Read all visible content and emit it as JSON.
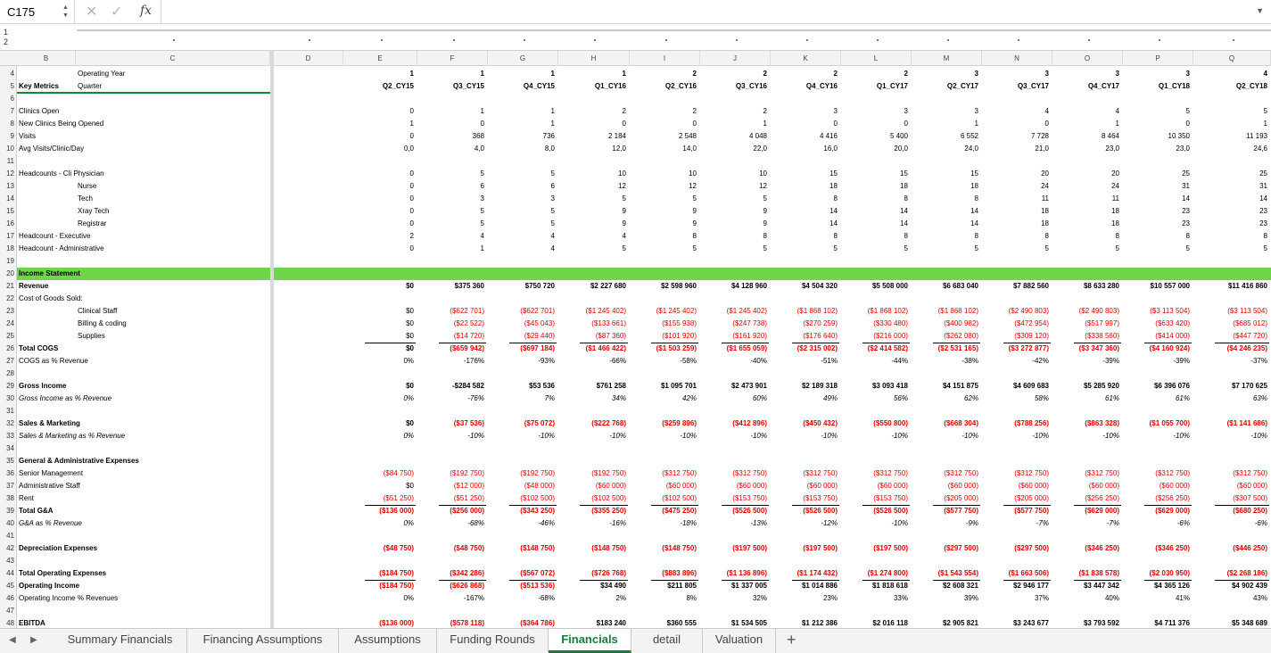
{
  "formula_bar": {
    "cell_ref": "C175",
    "cancel_icon": "✕",
    "confirm_icon": "✓",
    "fx_label": "fx",
    "formula": ""
  },
  "outline": {
    "levels": [
      "1",
      "2"
    ]
  },
  "columns": [
    "B",
    "C",
    "D",
    "E",
    "F",
    "G",
    "H",
    "I",
    "J",
    "K",
    "L",
    "M",
    "N",
    "O",
    "P",
    "Q"
  ],
  "period_columns": [
    "E",
    "F",
    "G",
    "H",
    "I",
    "J",
    "K",
    "L",
    "M",
    "N",
    "O",
    "P",
    "Q"
  ],
  "rows": [
    {
      "n": "1",
      "b": "",
      "c": "",
      "style": "",
      "values": []
    },
    {
      "n": "2",
      "b": "",
      "c": "",
      "style": "",
      "values": []
    },
    {
      "n": "4",
      "b": "",
      "c": "Operating Year",
      "style": "hdr",
      "values": [
        "1",
        "1",
        "1",
        "1",
        "2",
        "2",
        "2",
        "2",
        "3",
        "3",
        "3",
        "3",
        "4"
      ]
    },
    {
      "n": "5",
      "b": "Key Metrics",
      "c": "Quarter",
      "style": "hdr",
      "values": [
        "Q2_CY15",
        "Q3_CY15",
        "Q4_CY15",
        "Q1_CY16",
        "Q2_CY16",
        "Q3_CY16",
        "Q4_CY16",
        "Q1_CY17",
        "Q2_CY17",
        "Q3_CY17",
        "Q4_CY17",
        "Q1_CY18",
        "Q2_CY18"
      ]
    },
    {
      "n": "6",
      "b": "",
      "c": "",
      "style": "",
      "values": []
    },
    {
      "n": "7",
      "b": "Clinics Open",
      "c": "",
      "style": "",
      "values": [
        "0",
        "1",
        "1",
        "2",
        "2",
        "2",
        "3",
        "3",
        "3",
        "4",
        "4",
        "5",
        "5"
      ]
    },
    {
      "n": "8",
      "b": "New Clinics Being Opened",
      "c": "",
      "style": "",
      "values": [
        "1",
        "0",
        "1",
        "0",
        "0",
        "1",
        "0",
        "0",
        "1",
        "0",
        "1",
        "0",
        "1"
      ]
    },
    {
      "n": "9",
      "b": "Visits",
      "c": "",
      "style": "",
      "values": [
        "0",
        "368",
        "736",
        "2 184",
        "2 548",
        "4 048",
        "4 416",
        "5 400",
        "6 552",
        "7 728",
        "8 464",
        "10 350",
        "11 193"
      ]
    },
    {
      "n": "10",
      "b": "Avg Visits/Clinic/Day",
      "c": "",
      "style": "",
      "values": [
        "0,0",
        "4,0",
        "8,0",
        "12,0",
        "14,0",
        "22,0",
        "16,0",
        "20,0",
        "24,0",
        "21,0",
        "23,0",
        "23,0",
        "24,6"
      ]
    },
    {
      "n": "11",
      "b": "",
      "c": "",
      "style": "",
      "values": []
    },
    {
      "n": "12",
      "b": "Headcounts - Cli Physician",
      "c": "",
      "style": "",
      "values": [
        "0",
        "5",
        "5",
        "10",
        "10",
        "10",
        "15",
        "15",
        "15",
        "20",
        "20",
        "25",
        "25"
      ]
    },
    {
      "n": "13",
      "b": "",
      "c": "Nurse",
      "style": "",
      "values": [
        "0",
        "6",
        "6",
        "12",
        "12",
        "12",
        "18",
        "18",
        "18",
        "24",
        "24",
        "31",
        "31"
      ]
    },
    {
      "n": "14",
      "b": "",
      "c": "Tech",
      "style": "",
      "values": [
        "0",
        "3",
        "3",
        "5",
        "5",
        "5",
        "8",
        "8",
        "8",
        "11",
        "11",
        "14",
        "14"
      ]
    },
    {
      "n": "15",
      "b": "",
      "c": "Xray Tech",
      "style": "",
      "values": [
        "0",
        "5",
        "5",
        "9",
        "9",
        "9",
        "14",
        "14",
        "14",
        "18",
        "18",
        "23",
        "23"
      ]
    },
    {
      "n": "16",
      "b": "",
      "c": "Registrar",
      "style": "",
      "values": [
        "0",
        "5",
        "5",
        "9",
        "9",
        "9",
        "14",
        "14",
        "14",
        "18",
        "18",
        "23",
        "23"
      ]
    },
    {
      "n": "17",
      "b": "Headcount - Executive",
      "c": "",
      "style": "",
      "values": [
        "2",
        "4",
        "4",
        "4",
        "8",
        "8",
        "8",
        "8",
        "8",
        "8",
        "8",
        "8",
        "8"
      ]
    },
    {
      "n": "18",
      "b": "Headcount - Administrative",
      "c": "",
      "style": "",
      "values": [
        "0",
        "1",
        "4",
        "5",
        "5",
        "5",
        "5",
        "5",
        "5",
        "5",
        "5",
        "5",
        "5"
      ]
    },
    {
      "n": "19",
      "b": "",
      "c": "",
      "style": "",
      "values": []
    },
    {
      "n": "20",
      "b": "Income Statement",
      "c": "",
      "style": "hl",
      "values": []
    },
    {
      "n": "21",
      "b": "Revenue",
      "c": "",
      "style": "b",
      "values": [
        "$0",
        "$375 360",
        "$750 720",
        "$2 227 680",
        "$2 598 960",
        "$4 128 960",
        "$4 504 320",
        "$5 508 000",
        "$6 683 040",
        "$7 882 560",
        "$8 633 280",
        "$10 557 000",
        "$11 416 860"
      ]
    },
    {
      "n": "22",
      "b": "Cost of Goods Sold:",
      "c": "",
      "style": "",
      "values": []
    },
    {
      "n": "23",
      "b": "",
      "c": "Clinical Staff",
      "style": "neg",
      "values": [
        "$0",
        "($622 701)",
        "($622 701)",
        "($1 245 402)",
        "($1 245 402)",
        "($1 245 402)",
        "($1 868 102)",
        "($1 868 102)",
        "($1 868 102)",
        "($2 490 803)",
        "($2 490 803)",
        "($3 113 504)",
        "($3 113 504)"
      ]
    },
    {
      "n": "24",
      "b": "",
      "c": "Billing & coding",
      "style": "neg",
      "values": [
        "$0",
        "($22 522)",
        "($45 043)",
        "($133 661)",
        "($155 938)",
        "($247 738)",
        "($270 259)",
        "($330 480)",
        "($400 982)",
        "($472 954)",
        "($517 997)",
        "($633 420)",
        "($685 012)"
      ]
    },
    {
      "n": "25",
      "b": "",
      "c": "Supplies",
      "style": "neg",
      "values": [
        "$0",
        "($14 720)",
        "($29 440)",
        "($87 360)",
        "($101 920)",
        "($161 920)",
        "($176 640)",
        "($216 000)",
        "($262 080)",
        "($309 120)",
        "($338 560)",
        "($414 000)",
        "($447 720)"
      ]
    },
    {
      "n": "26",
      "b": "Total COGS",
      "c": "",
      "style": "b neg",
      "values": [
        "$0",
        "($659 942)",
        "($697 184)",
        "($1 466 422)",
        "($1 503 259)",
        "($1 655 059)",
        "($2 315 002)",
        "($2 414 582)",
        "($2 531 165)",
        "($3 272 877)",
        "($3 347 360)",
        "($4 160 924)",
        "($4 246 235)"
      ]
    },
    {
      "n": "27",
      "b": "COGS as % Revenue",
      "c": "",
      "style": "",
      "values": [
        "0%",
        "-176%",
        "-93%",
        "-66%",
        "-58%",
        "-40%",
        "-51%",
        "-44%",
        "-38%",
        "-42%",
        "-39%",
        "-39%",
        "-37%"
      ]
    },
    {
      "n": "28",
      "b": "",
      "c": "",
      "style": "",
      "values": []
    },
    {
      "n": "29",
      "b": "Gross Income",
      "c": "",
      "style": "b",
      "values": [
        "$0",
        "-$284 582",
        "$53 536",
        "$761 258",
        "$1 095 701",
        "$2 473 901",
        "$2 189 318",
        "$3 093 418",
        "$4 151 875",
        "$4 609 683",
        "$5 285 920",
        "$6 396 076",
        "$7 170 625"
      ]
    },
    {
      "n": "30",
      "b": "Gross Income as % Revenue",
      "c": "",
      "style": "i",
      "values": [
        "0%",
        "-76%",
        "7%",
        "34%",
        "42%",
        "60%",
        "49%",
        "56%",
        "62%",
        "58%",
        "61%",
        "61%",
        "63%"
      ]
    },
    {
      "n": "31",
      "b": "",
      "c": "",
      "style": "",
      "values": []
    },
    {
      "n": "32",
      "b": "Sales & Marketing",
      "c": "",
      "style": "b negv",
      "values": [
        "$0",
        "($37 536)",
        "($75 072)",
        "($222 768)",
        "($259 896)",
        "($412 896)",
        "($450 432)",
        "($550 800)",
        "($668 304)",
        "($788 256)",
        "($863 328)",
        "($1 055 700)",
        "($1 141 686)"
      ]
    },
    {
      "n": "33",
      "b": "Sales & Marketing as % Revenue",
      "c": "",
      "style": "i",
      "values": [
        "0%",
        "-10%",
        "-10%",
        "-10%",
        "-10%",
        "-10%",
        "-10%",
        "-10%",
        "-10%",
        "-10%",
        "-10%",
        "-10%",
        "-10%"
      ]
    },
    {
      "n": "34",
      "b": "",
      "c": "",
      "style": "",
      "values": []
    },
    {
      "n": "35",
      "b": "General & Administrative Expenses",
      "c": "",
      "style": "b",
      "values": []
    },
    {
      "n": "36",
      "b": "Senior Management",
      "c": "",
      "style": "neg",
      "values": [
        "($84 750)",
        "($192 750)",
        "($192 750)",
        "($192 750)",
        "($312 750)",
        "($312 750)",
        "($312 750)",
        "($312 750)",
        "($312 750)",
        "($312 750)",
        "($312 750)",
        "($312 750)",
        "($312 750)"
      ]
    },
    {
      "n": "37",
      "b": "Administrative Staff",
      "c": "",
      "style": "neg",
      "values": [
        "$0",
        "($12 000)",
        "($48 000)",
        "($60 000)",
        "($60 000)",
        "($60 000)",
        "($60 000)",
        "($60 000)",
        "($60 000)",
        "($60 000)",
        "($60 000)",
        "($60 000)",
        "($60 000)"
      ]
    },
    {
      "n": "38",
      "b": "Rent",
      "c": "",
      "style": "neg",
      "values": [
        "($51 250)",
        "($51 250)",
        "($102 500)",
        "($102 500)",
        "($102 500)",
        "($153 750)",
        "($153 750)",
        "($153 750)",
        "($205 000)",
        "($205 000)",
        "($256 250)",
        "($256 250)",
        "($307 500)"
      ]
    },
    {
      "n": "39",
      "b": "Total G&A",
      "c": "",
      "style": "b neg",
      "values": [
        "($136 000)",
        "($256 000)",
        "($343 250)",
        "($355 250)",
        "($475 250)",
        "($526 500)",
        "($526 500)",
        "($526 500)",
        "($577 750)",
        "($577 750)",
        "($629 000)",
        "($629 000)",
        "($680 250)"
      ]
    },
    {
      "n": "40",
      "b": "G&A as % Revenue",
      "c": "",
      "style": "i",
      "values": [
        "0%",
        "-68%",
        "-46%",
        "-16%",
        "-18%",
        "-13%",
        "-12%",
        "-10%",
        "-9%",
        "-7%",
        "-7%",
        "-6%",
        "-6%"
      ]
    },
    {
      "n": "41",
      "b": "",
      "c": "",
      "style": "",
      "values": []
    },
    {
      "n": "42",
      "b": "Depreciation Expenses",
      "c": "",
      "style": "b neg",
      "values": [
        "($48 750)",
        "($48 750)",
        "($148 750)",
        "($148 750)",
        "($148 750)",
        "($197 500)",
        "($197 500)",
        "($197 500)",
        "($297 500)",
        "($297 500)",
        "($346 250)",
        "($346 250)",
        "($446 250)"
      ]
    },
    {
      "n": "43",
      "b": "",
      "c": "",
      "style": "",
      "values": []
    },
    {
      "n": "44",
      "b": "Total Operating Expenses",
      "c": "",
      "style": "b neg",
      "values": [
        "($184 750)",
        "($342 286)",
        "($567 072)",
        "($726 768)",
        "($883 896)",
        "($1 136 896)",
        "($1 174 432)",
        "($1 274 800)",
        "($1 543 554)",
        "($1 663 506)",
        "($1 838 578)",
        "($2 030 950)",
        "($2 268 186)"
      ]
    },
    {
      "n": "45",
      "b": "Operating Income",
      "c": "",
      "style": "b mixed",
      "values": [
        "($184 750)",
        "($626 868)",
        "($513 536)",
        "$34 490",
        "$211 805",
        "$1 337 005",
        "$1 014 886",
        "$1 818 618",
        "$2 608 321",
        "$2 946 177",
        "$3 447 342",
        "$4 365 126",
        "$4 902 439"
      ]
    },
    {
      "n": "46",
      "b": "Operating Income % Revenues",
      "c": "",
      "style": "",
      "values": [
        "0%",
        "-167%",
        "-68%",
        "2%",
        "8%",
        "32%",
        "23%",
        "33%",
        "39%",
        "37%",
        "40%",
        "41%",
        "43%"
      ]
    },
    {
      "n": "47",
      "b": "",
      "c": "",
      "style": "",
      "values": []
    },
    {
      "n": "48",
      "b": "EBITDA",
      "c": "",
      "style": "b mixed",
      "values": [
        "($136 000)",
        "($578 118)",
        "($364 786)",
        "$183 240",
        "$360 555",
        "$1 534 505",
        "$1 212 386",
        "$2 016 118",
        "$2 905 821",
        "$3 243 677",
        "$3 793 592",
        "$4 711 376",
        "$5 348 689"
      ]
    }
  ],
  "tabs": [
    {
      "label": "Summary Financials",
      "active": false
    },
    {
      "label": "Financing Assumptions",
      "active": false
    },
    {
      "label": "Assumptions",
      "active": false
    },
    {
      "label": "Funding Rounds",
      "active": false
    },
    {
      "label": "Financials",
      "active": true
    },
    {
      "label": "detail",
      "active": false
    },
    {
      "label": "Valuation",
      "active": false
    }
  ],
  "add_sheet_label": "+",
  "colors": {
    "accent": "#1e7a3c",
    "highlight": "#6fd64a",
    "negative": "#e00000"
  }
}
